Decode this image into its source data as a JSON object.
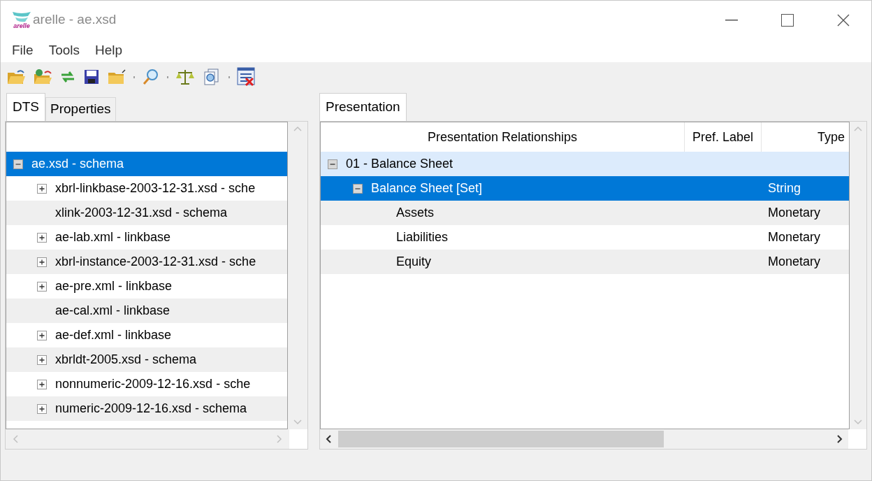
{
  "window": {
    "title": "arelle - ae.xsd",
    "logo_text": "arelle"
  },
  "menu": [
    "File",
    "Tools",
    "Help"
  ],
  "toolbar": [
    {
      "kind": "open"
    },
    {
      "kind": "open-web"
    },
    {
      "kind": "reload"
    },
    {
      "kind": "save"
    },
    {
      "kind": "folder"
    },
    {
      "kind": "separator"
    },
    {
      "kind": "find"
    },
    {
      "kind": "separator"
    },
    {
      "kind": "validate"
    },
    {
      "kind": "compare"
    },
    {
      "kind": "separator"
    },
    {
      "kind": "close"
    }
  ],
  "left_tabs": [
    {
      "label": "DTS",
      "selected": true
    },
    {
      "label": "Properties",
      "selected": false
    }
  ],
  "dts_tree": [
    {
      "label": "ae.xsd - schema",
      "expandable": true,
      "expanded": true,
      "selected": true,
      "children": [
        {
          "label": "xbrl-linkbase-2003-12-31.xsd - sche",
          "expandable": true,
          "expanded": false,
          "selected": false
        },
        {
          "label": "xlink-2003-12-31.xsd - schema",
          "expandable": false,
          "selected": false
        },
        {
          "label": "ae-lab.xml - linkbase",
          "expandable": true,
          "expanded": false,
          "selected": false
        },
        {
          "label": "xbrl-instance-2003-12-31.xsd - sche",
          "expandable": true,
          "expanded": false,
          "selected": false
        },
        {
          "label": "ae-pre.xml - linkbase",
          "expandable": true,
          "expanded": false,
          "selected": false
        },
        {
          "label": "ae-cal.xml - linkbase",
          "expandable": false,
          "selected": false
        },
        {
          "label": "ae-def.xml - linkbase",
          "expandable": true,
          "expanded": false,
          "selected": false
        },
        {
          "label": "xbrldt-2005.xsd - schema",
          "expandable": true,
          "expanded": false,
          "selected": false
        },
        {
          "label": "nonnumeric-2009-12-16.xsd - sche",
          "expandable": true,
          "expanded": false,
          "selected": false
        },
        {
          "label": "numeric-2009-12-16.xsd - schema",
          "expandable": true,
          "expanded": false,
          "selected": false
        }
      ]
    }
  ],
  "right_tabs": [
    {
      "label": "Presentation",
      "selected": true
    }
  ],
  "table": {
    "columns": [
      "Presentation Relationships",
      "Pref. Label",
      "Type"
    ],
    "rows": [
      {
        "label": "01 - Balance Sheet",
        "expandable": true,
        "expanded": true,
        "selected": false,
        "hovered": true,
        "children": [
          {
            "label": "Balance Sheet [Set]",
            "type": "String",
            "expandable": true,
            "expanded": true,
            "selected": true,
            "hovered": false,
            "children": [
              {
                "label": "Assets",
                "type": "Monetary",
                "expandable": false,
                "selected": false,
                "hovered": false
              },
              {
                "label": "Liabilities",
                "type": "Monetary",
                "expandable": false,
                "selected": false,
                "hovered": false
              },
              {
                "label": "Equity",
                "type": "Monetary",
                "expandable": false,
                "selected": false,
                "hovered": false
              }
            ]
          }
        ]
      }
    ]
  }
}
